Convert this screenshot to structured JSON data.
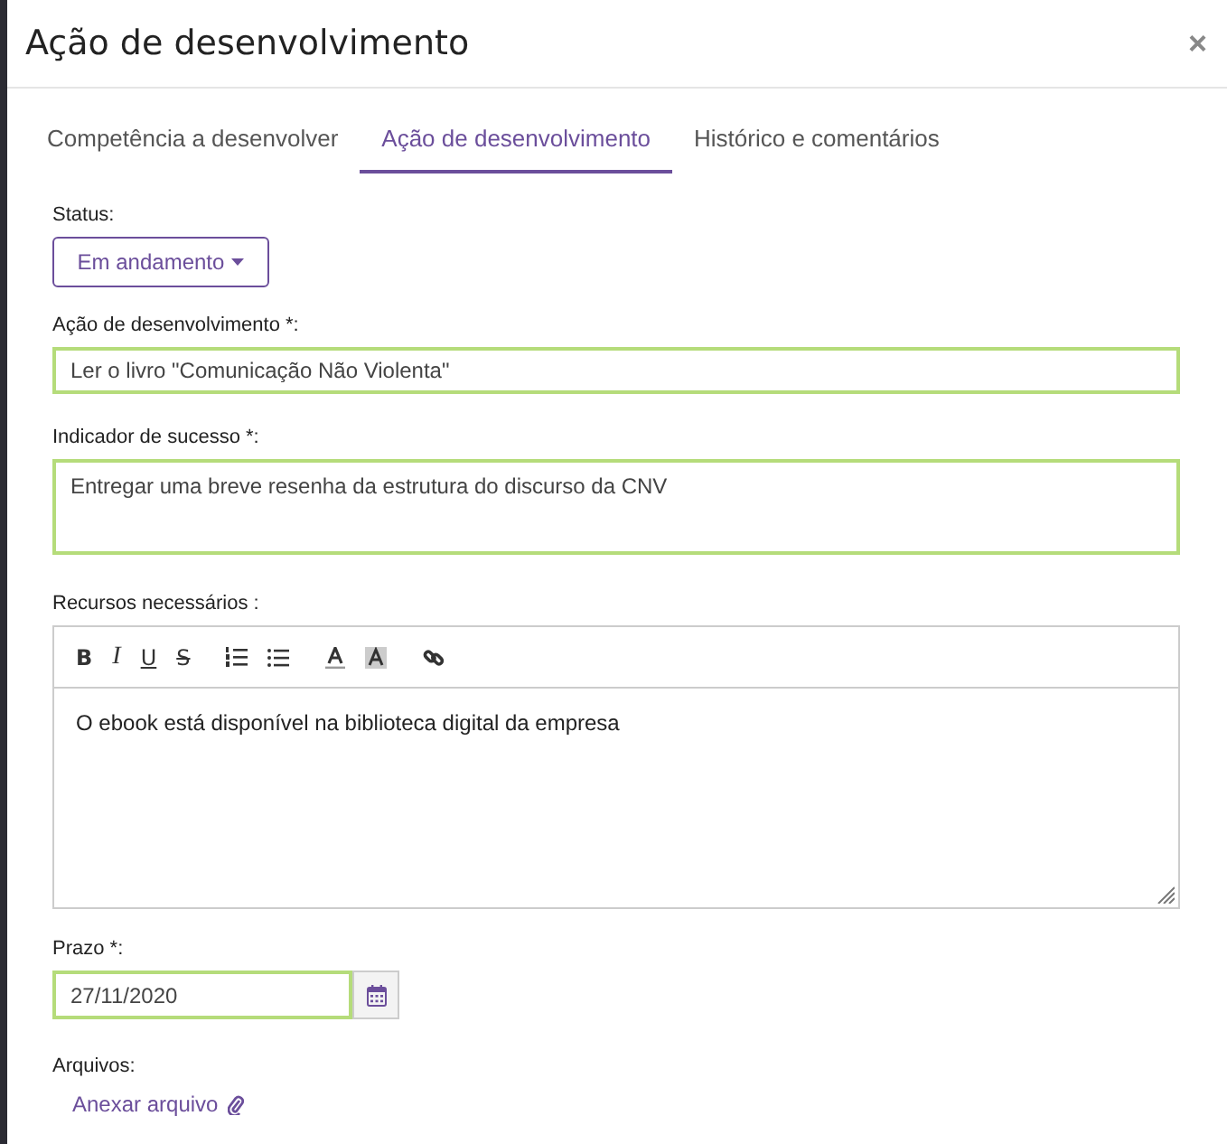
{
  "modal": {
    "title": "Ação de desenvolvimento",
    "close": "×"
  },
  "tabs": [
    {
      "label": "Competência a desenvolver",
      "selected": false
    },
    {
      "label": "Ação de desenvolvimento",
      "selected": true
    },
    {
      "label": "Histórico e comentários",
      "selected": false
    }
  ],
  "status": {
    "label": "Status:",
    "value": "Em andamento"
  },
  "action": {
    "label": "Ação de desenvolvimento *:",
    "value": "Ler o livro \"Comunicação Não Violenta\""
  },
  "indicator": {
    "label": "Indicador de sucesso *:",
    "value": "Entregar uma breve resenha da estrutura do discurso da CNV"
  },
  "resources": {
    "label": "Recursos necessários :",
    "toolbar": [
      [
        {
          "kind": "bold",
          "glyph": "B"
        },
        {
          "kind": "italic",
          "glyph": "I"
        },
        {
          "kind": "underline",
          "glyph": "U"
        },
        {
          "kind": "strike",
          "glyph": "S"
        }
      ],
      [
        {
          "kind": "ordered-list"
        },
        {
          "kind": "bullet-list"
        }
      ],
      [
        {
          "kind": "text-color"
        },
        {
          "kind": "highlight"
        }
      ],
      [
        {
          "kind": "link"
        }
      ]
    ],
    "value": "O ebook está disponível na biblioteca digital da empresa"
  },
  "deadline": {
    "label": "Prazo *:",
    "value": "27/11/2020"
  },
  "files": {
    "label": "Arquivos:",
    "link": "Anexar arquivo"
  }
}
